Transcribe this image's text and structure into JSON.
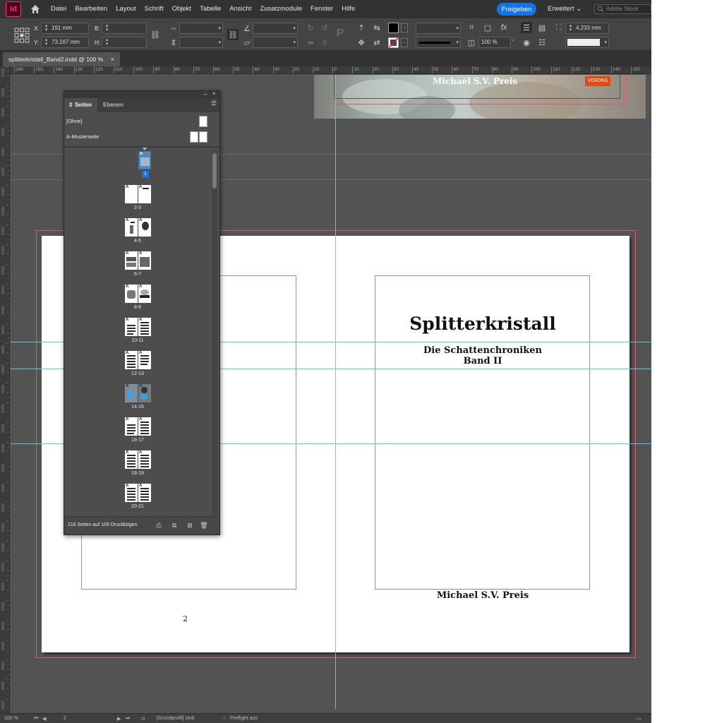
{
  "app": {
    "logo_text": "Id",
    "menu": [
      "Datei",
      "Bearbeiten",
      "Layout",
      "Schrift",
      "Objekt",
      "Tabelle",
      "Ansicht",
      "Zusatzmodule",
      "Fenster",
      "Hilfe"
    ],
    "share_label": "Freigeben",
    "workspace_label": "Erweitert",
    "stock_placeholder": "Adobe Stock",
    "brand_color": "#ff3366",
    "accent_color": "#1473e6"
  },
  "control_bar": {
    "x_label": "X:",
    "x_value": "191 mm",
    "y_label": "Y:",
    "y_value": "73,167 mm",
    "w_label": "B:",
    "h_label": "H:",
    "scale_value": "100 %",
    "stroke_weight": "4,233 mm"
  },
  "document": {
    "tab_title": "splitterkristall_Band2.indd @ 100 %",
    "tab_close": "×"
  },
  "ruler": {
    "ticks": [
      "160",
      "150",
      "140",
      "130",
      "120",
      "110",
      "100",
      "90",
      "80",
      "70",
      "60",
      "50",
      "40",
      "30",
      "20",
      "10",
      "0",
      "10",
      "20",
      "30",
      "40",
      "50",
      "60",
      "70",
      "80",
      "90",
      "100",
      "110",
      "120",
      "130",
      "140",
      "150"
    ]
  },
  "spread": {
    "prev_author": "Michael S.V. Preis",
    "prev_logo": "VISIONS",
    "title": "Splitterkristall",
    "subtitle_line1": "Die Schattenchroniken",
    "subtitle_line2": "Band II",
    "author": "Michael S.V. Preis",
    "left_page_number": "2"
  },
  "pages_panel": {
    "tab_pages": "Seiten",
    "tab_layers": "Ebenen",
    "master_none": "[Ohne]",
    "master_a": "A-Musterseite",
    "spreads": [
      {
        "label": "1",
        "kind": "cover"
      },
      {
        "label": "2-3",
        "kind": "blank"
      },
      {
        "label": "4-5",
        "kind": "image"
      },
      {
        "label": "6-7",
        "kind": "image"
      },
      {
        "label": "8-9",
        "kind": "image"
      },
      {
        "label": "10-11",
        "kind": "text"
      },
      {
        "label": "12-13",
        "kind": "text"
      },
      {
        "label": "14-15",
        "kind": "photo"
      },
      {
        "label": "16-17",
        "kind": "text"
      },
      {
        "label": "18-19",
        "kind": "text"
      },
      {
        "label": "20-21",
        "kind": "text"
      }
    ],
    "page_count": "216 Seiten auf 109 Druckbögen"
  },
  "status_bar": {
    "zoom": "100 %",
    "page": "2",
    "preflight_profile": "[Grundprofil] (Arb",
    "preflight_state": "Preflight aus"
  }
}
